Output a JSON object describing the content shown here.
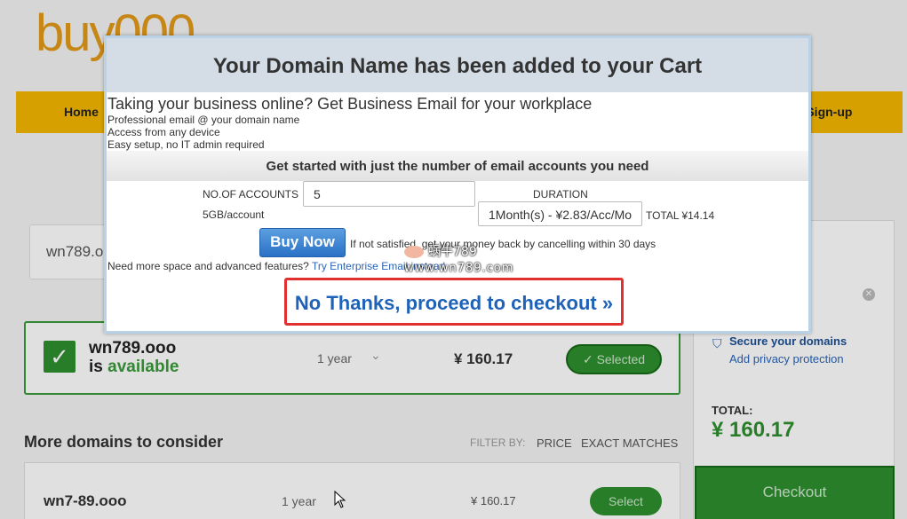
{
  "brand": {
    "logo_text": "buy000"
  },
  "nav": {
    "home": "Home",
    "signup": "r Sign-up"
  },
  "search": {
    "value": "wn789.o"
  },
  "available": {
    "domain": "wn789.ooo",
    "status_prefix": "is",
    "status_word": "available",
    "term": "1 year",
    "price": "¥ 160.17",
    "selected_label": "Selected"
  },
  "more": {
    "title": "More domains to consider",
    "filter_label": "FILTER BY:",
    "filter_price": "PRICE",
    "filter_exact": "EXACT MATCHES"
  },
  "suggestion": {
    "domain": "wn7-89.ooo",
    "term": "1 year",
    "price": "¥ 160.17",
    "select_label": "Select"
  },
  "cart": {
    "secure_text": "Secure your domains",
    "privacy_link": "Add privacy protection",
    "total_label": "TOTAL:",
    "total_value": "¥ 160.17",
    "checkout_label": "Checkout"
  },
  "modal": {
    "title": "Your Domain Name has been added to your Cart",
    "promo_heading": "Taking your business online? Get Business Email for your workplace",
    "promo_lines": [
      "Professional email @ your domain name",
      "Access from any device",
      "Easy setup, no IT admin required"
    ],
    "start_text": "Get started with just the number of email accounts you need",
    "accounts_label": "NO.OF ACCOUNTS",
    "accounts_value": "5",
    "gb_label": "5GB/account",
    "duration_label": "DURATION",
    "duration_value": "1Month(s) - ¥2.83/Acc/Mo",
    "total_text": "TOTAL ¥14.14",
    "buy_label": "Buy Now",
    "refund_text": "If not satisfied, get your money back by cancelling within 30 days",
    "enterprise_prefix": "Need more space and advanced features?",
    "enterprise_link": "Try Enterprise Email instead",
    "no_thanks_label": "No Thanks, proceed to checkout »"
  },
  "watermark": {
    "text": "蜗牛789",
    "url": "www.wn789.com"
  }
}
